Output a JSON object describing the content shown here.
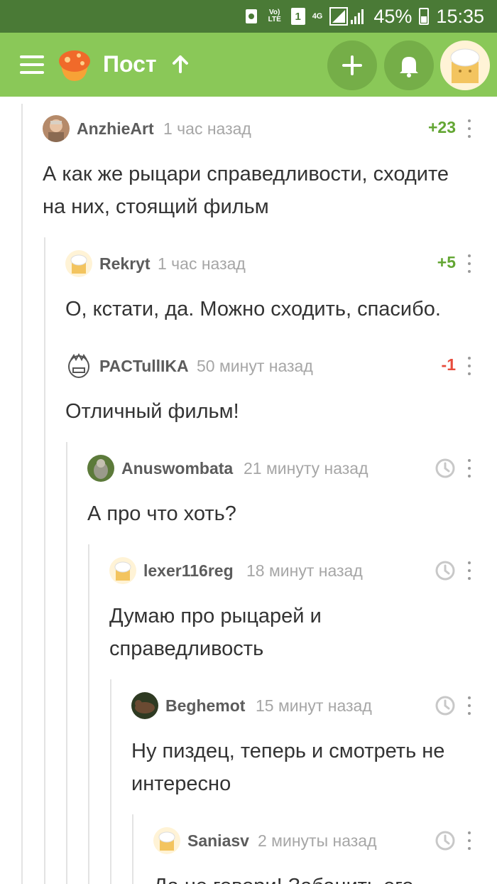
{
  "status_bar": {
    "volte": "Vo) LTE",
    "sim": "1",
    "network": "4G",
    "battery": "45%",
    "time": "15:35"
  },
  "header": {
    "title": "Пост",
    "menu_icon": "hamburger-menu-icon",
    "logo_icon": "pikabu-logo-icon",
    "add_icon": "plus-icon",
    "bell_icon": "bell-icon",
    "accent_color": "#8ac858"
  },
  "comments": [
    {
      "author": "AnzhieArt",
      "time": "1 час назад",
      "score": "+23",
      "score_type": "positive",
      "text": "А как же рыцари справедливости, сходите на них, стоящий фильм"
    },
    {
      "author": "Rekryt",
      "time": "1 час назад",
      "score": "+5",
      "score_type": "positive",
      "text": "О, кстати, да. Можно сходить, спасибо."
    },
    {
      "author": "PACTullIKA",
      "time": "50 минут назад",
      "score": "-1",
      "score_type": "negative",
      "text": "Отличный фильм!"
    },
    {
      "author": "Anuswombata",
      "time": "21 минуту назад",
      "score": "",
      "score_type": "pending",
      "text": "А про что хоть?"
    },
    {
      "author": "lexer116reg",
      "time": "18 минут назад",
      "score": "",
      "score_type": "pending",
      "text": "Думаю про рыцарей и справедливость"
    },
    {
      "author": "Beghemot",
      "time": "15 минут назад",
      "score": "",
      "score_type": "pending",
      "text": "Ну пиздец, теперь и смотреть не интересно"
    },
    {
      "author": "Saniasv",
      "time": "2 минуты назад",
      "score": "",
      "score_type": "pending",
      "text": "Да не говори! Забанить его"
    }
  ]
}
